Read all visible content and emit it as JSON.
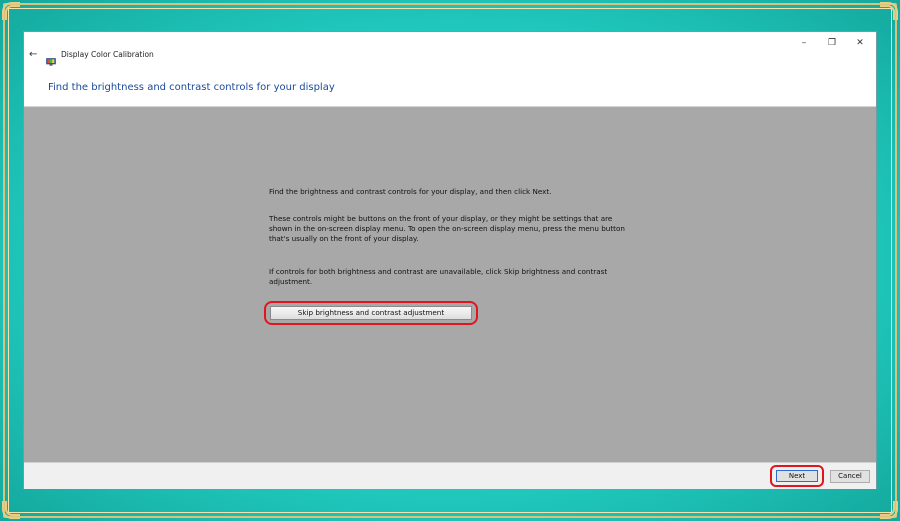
{
  "window": {
    "title": "Display Color Calibration",
    "back_icon": "back-arrow-icon",
    "app_icon": "monitor-color-icon",
    "controls": {
      "minimize_glyph": "–",
      "restore_glyph": "❐",
      "close_glyph": "✕"
    }
  },
  "header": {
    "title": "Find the brightness and contrast controls for your display"
  },
  "content": {
    "paragraph1": "Find the brightness and contrast controls for your display, and then click Next.",
    "paragraph2": "These controls might be buttons on the front of your display, or they might be settings that are shown in the on-screen display menu. To open the on-screen display menu, press the menu button that's usually on the front of your display.",
    "paragraph3": "If controls for both brightness and contrast are unavailable, click Skip brightness and contrast adjustment.",
    "skip_button": "Skip brightness and contrast adjustment"
  },
  "footer": {
    "next_label": "Next",
    "cancel_label": "Cancel"
  },
  "colors": {
    "header_text": "#1a4a9a",
    "content_background": "#a8a8a8",
    "highlight": "#e0161e",
    "frame_teal": "#23cfc3",
    "frame_gold": "#d9c27a"
  }
}
